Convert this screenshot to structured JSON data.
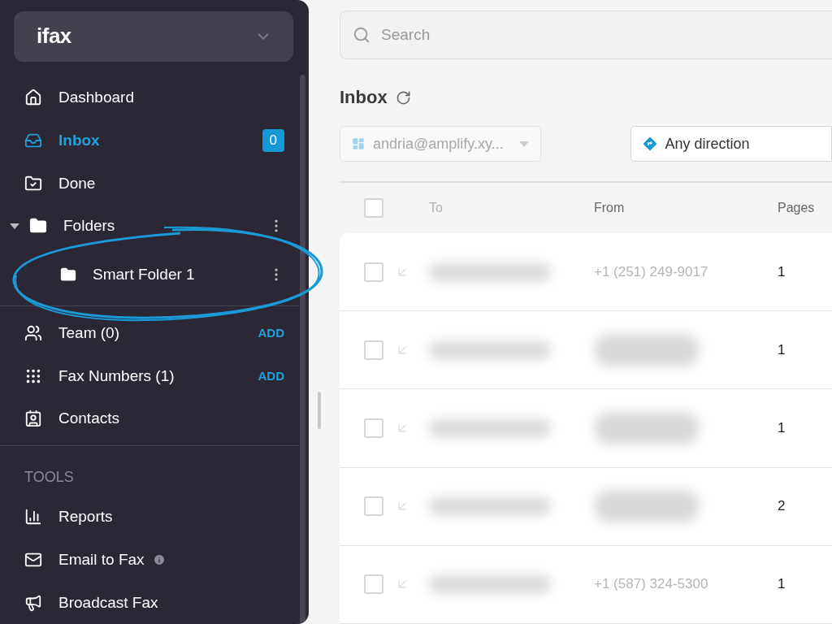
{
  "sidebar": {
    "logo": "ifax",
    "main_items": [
      {
        "label": "Dashboard",
        "selected": false
      },
      {
        "label": "Inbox",
        "selected": true,
        "badge": "0"
      },
      {
        "label": "Done",
        "selected": false
      }
    ],
    "folders": {
      "label": "Folders",
      "expanded": true,
      "children": [
        {
          "label": "Smart Folder 1"
        }
      ]
    },
    "team_items": [
      {
        "label": "Team (0)",
        "action": "ADD"
      },
      {
        "label": "Fax Numbers (1)",
        "action": "ADD"
      },
      {
        "label": "Contacts"
      }
    ],
    "tools": {
      "heading": "TOOLS",
      "items": [
        {
          "label": "Reports",
          "info": false
        },
        {
          "label": "Email to Fax",
          "info": true
        },
        {
          "label": "Broadcast Fax",
          "info": false
        }
      ]
    }
  },
  "search": {
    "placeholder": "Search"
  },
  "inbox": {
    "title": "Inbox",
    "account_filter": "andria@amplify.xy...",
    "direction_filter": "Any direction"
  },
  "table": {
    "select_all": {
      "checked": false
    },
    "columns": [
      "To",
      "From",
      "Pages"
    ],
    "rows": [
      {
        "checked": false,
        "from": "+1 (251) 249-9017",
        "pages": "1"
      },
      {
        "checked": false,
        "pages": "1"
      },
      {
        "checked": false,
        "pages": "1"
      },
      {
        "checked": false,
        "pages": "2"
      },
      {
        "checked": false,
        "from": "+1 (587) 324-5300",
        "pages": "1"
      }
    ]
  }
}
